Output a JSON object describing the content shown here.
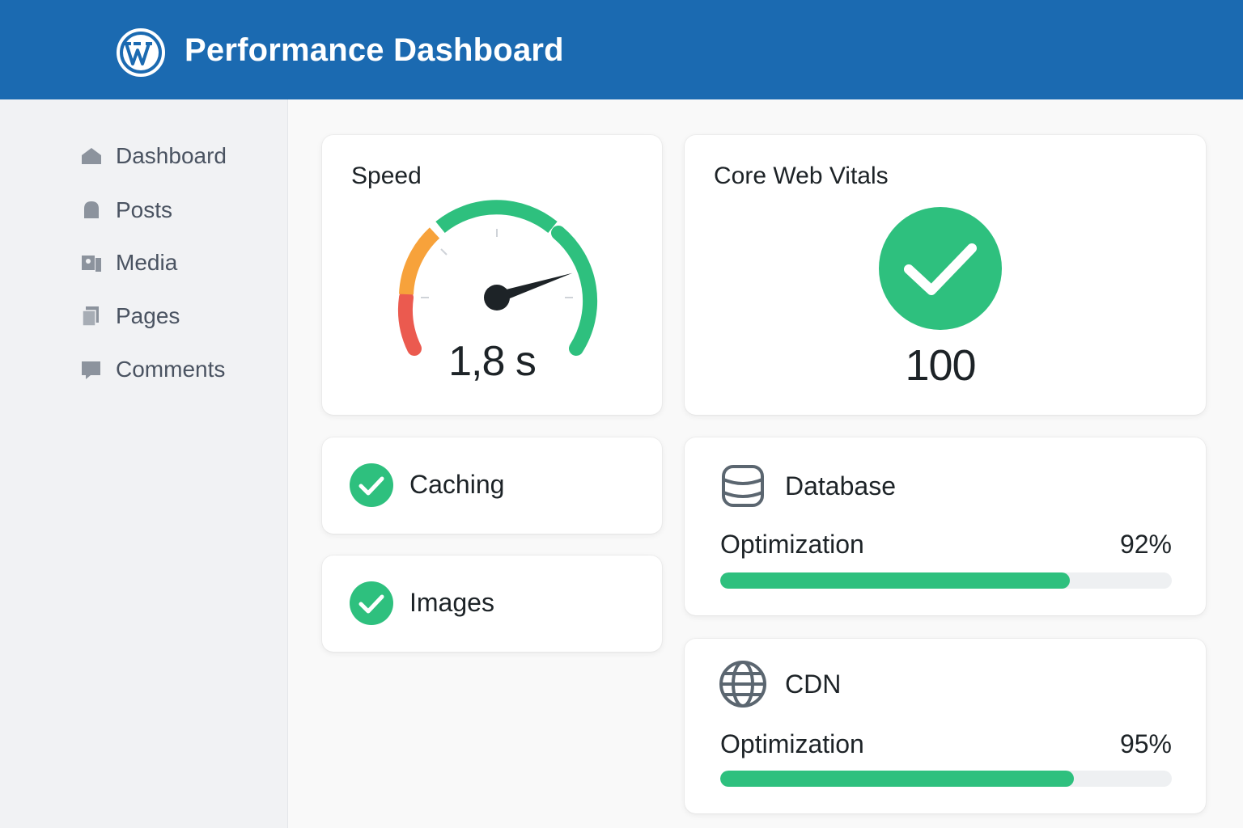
{
  "header": {
    "title": "Performance Dashboard",
    "logo_icon": "wordpress-icon",
    "background": "#1b6ab1"
  },
  "sidebar": {
    "items": [
      {
        "label": "Dashboard",
        "icon": "home-icon"
      },
      {
        "label": "Posts",
        "icon": "pin-icon"
      },
      {
        "label": "Media",
        "icon": "media-icon"
      },
      {
        "label": "Pages",
        "icon": "pages-icon"
      },
      {
        "label": "Comments",
        "icon": "comment-icon"
      }
    ]
  },
  "speed": {
    "title": "Speed",
    "value": "1,8 s",
    "needle_level": 0.8
  },
  "vitals": {
    "title": "Core Web Vitals",
    "score": "100",
    "status_color": "#2ec07e"
  },
  "checks": [
    {
      "label": "Caching",
      "icon": "check-circle-icon"
    },
    {
      "label": "Images",
      "icon": "check-circle-icon"
    }
  ],
  "database": {
    "title": "Database",
    "icon": "database-icon",
    "metric_label": "Optimization",
    "metric_value": "92%",
    "fill": 0.774
  },
  "cdn": {
    "title": "CDN",
    "icon": "globe-icon",
    "metric_label": "Optimization",
    "metric_value": "95%",
    "fill": 0.783
  },
  "colors": {
    "accent_green": "#2ec07e",
    "gauge_orange": "#f7a23b",
    "gauge_red": "#eb5a4f"
  }
}
